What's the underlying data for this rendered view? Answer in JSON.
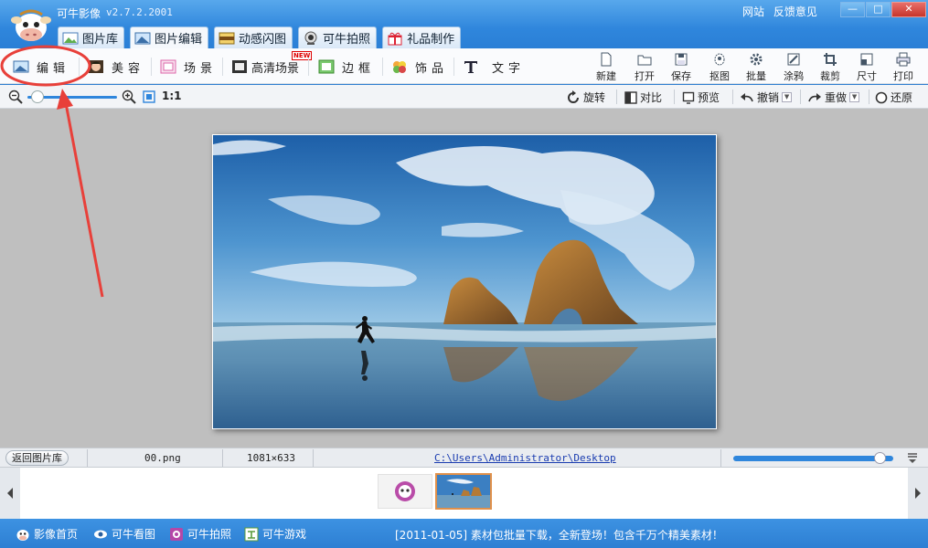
{
  "app": {
    "title": "可牛影像",
    "version": "v2.7.2.2001"
  },
  "top_links": [
    "网站",
    "反馈意见"
  ],
  "window_controls": {
    "minimize": "—",
    "maximize": "□",
    "close": "✕"
  },
  "tabs": [
    {
      "label": "图片库",
      "icon": "picture-library-icon",
      "active": false
    },
    {
      "label": "图片编辑",
      "icon": "image-edit-icon",
      "active": true
    },
    {
      "label": "动感闪图",
      "icon": "animation-icon",
      "active": false
    },
    {
      "label": "可牛拍照",
      "icon": "webcam-icon",
      "active": false
    },
    {
      "label": "礼品制作",
      "icon": "gift-icon",
      "active": false
    }
  ],
  "edit_tools": [
    {
      "label": "编辑",
      "icon": "edit-landscape-icon"
    },
    {
      "label": "美容",
      "icon": "beauty-icon"
    },
    {
      "label": "场景",
      "icon": "scene-icon"
    },
    {
      "label": "高清场景",
      "icon": "hd-scene-icon",
      "badge": "NEW"
    },
    {
      "label": "边框",
      "icon": "frame-icon"
    },
    {
      "label": "饰品",
      "icon": "clover-icon"
    },
    {
      "label": "文字",
      "icon": "text-icon"
    }
  ],
  "file_tools": [
    {
      "label": "新建",
      "icon": "new-file-icon"
    },
    {
      "label": "打开",
      "icon": "open-folder-icon"
    },
    {
      "label": "保存",
      "icon": "save-icon"
    },
    {
      "label": "抠图",
      "icon": "cutout-icon"
    },
    {
      "label": "批量",
      "icon": "batch-icon"
    },
    {
      "label": "涂鸦",
      "icon": "doodle-icon"
    },
    {
      "label": "裁剪",
      "icon": "crop-icon"
    },
    {
      "label": "尺寸",
      "icon": "resize-icon"
    },
    {
      "label": "打印",
      "icon": "print-icon"
    }
  ],
  "zoom": {
    "ratio_label": "1:1",
    "level": 0.05
  },
  "view_tools": [
    {
      "label": "旋转",
      "icon": "rotate-icon"
    },
    {
      "label": "对比",
      "icon": "compare-icon"
    },
    {
      "label": "预览",
      "icon": "preview-icon"
    },
    {
      "label": "撤销",
      "icon": "undo-icon"
    },
    {
      "label": "重做",
      "icon": "redo-icon"
    },
    {
      "label": "还原",
      "icon": "restore-icon"
    }
  ],
  "status": {
    "back_label": "返回图片库",
    "file_name": "00.png",
    "dimensions": "1081×633",
    "path": "C:\\Users\\Administrator\\Desktop",
    "thumb_size_level": 0.95
  },
  "bottom_links": [
    {
      "label": "影像首页",
      "icon": "cow-icon"
    },
    {
      "label": "可牛看图",
      "icon": "eye-icon"
    },
    {
      "label": "可牛拍照",
      "icon": "camera-icon"
    },
    {
      "label": "可牛游戏",
      "icon": "game-icon"
    }
  ],
  "news": "[2011-01-05] 素材包批量下载，全新登场！包含千万个精美素材！",
  "colors": {
    "title_blue": "#2f86dc",
    "annotation_red": "#e8403a",
    "selection_orange": "#e0904a"
  }
}
